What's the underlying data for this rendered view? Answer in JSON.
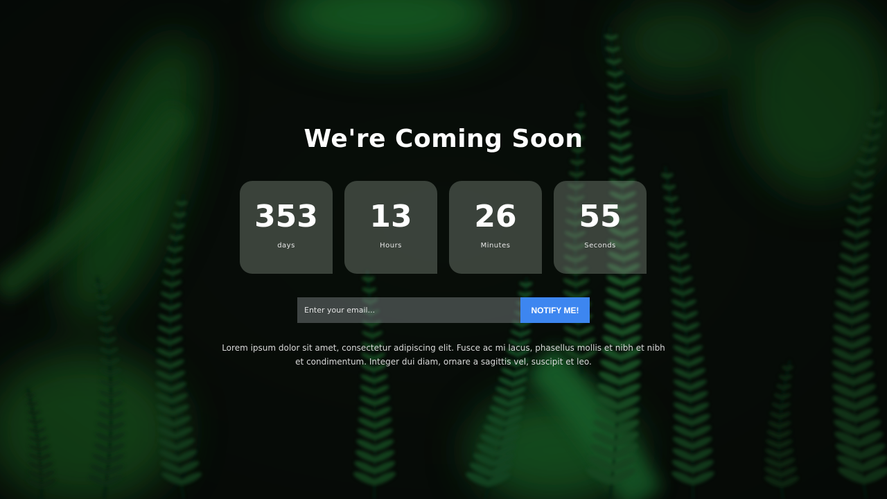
{
  "page": {
    "title": "We're Coming Soon",
    "description": "Lorem ipsum dolor sit amet, consectetur adipiscing elit. Fusce ac mi lacus, phasellus mollis et nibh et nibh et condimentum. Integer dui diam, ornare a sagittis vel, suscipit et leo."
  },
  "countdown": [
    {
      "value": "353",
      "label": "days"
    },
    {
      "value": "13",
      "label": "Hours"
    },
    {
      "value": "26",
      "label": "Minutes"
    },
    {
      "value": "55",
      "label": "Seconds"
    }
  ],
  "subscribe": {
    "placeholder": "Enter your email...",
    "value": "",
    "button_label": "NOTIFY ME!"
  },
  "colors": {
    "accent": "#3d86f0",
    "background": "#0b120c",
    "fern": "#1f6b34"
  },
  "background_image": "fern-leaves-photo"
}
